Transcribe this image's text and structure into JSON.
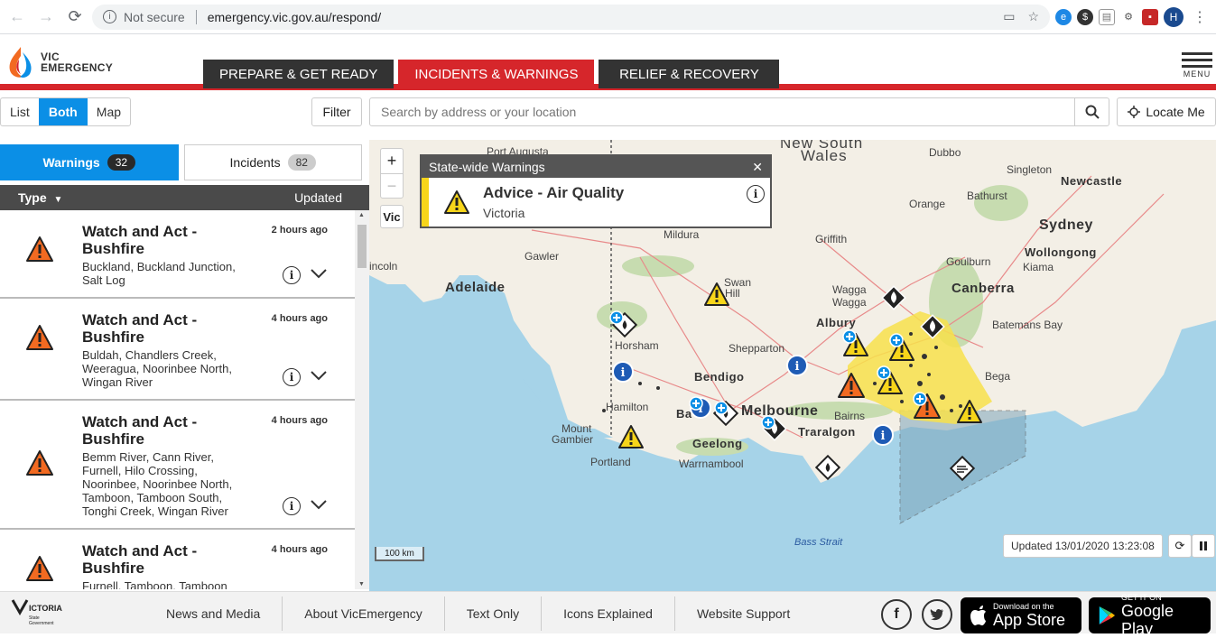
{
  "browser": {
    "security": "Not secure",
    "url": "emergency.vic.gov.au/respond/",
    "profile_initial": "H"
  },
  "site": {
    "logo_line1": "VIC",
    "logo_line2": "EMERGENCY",
    "nav": [
      {
        "label": "PREPARE & GET READY"
      },
      {
        "label": "INCIDENTS & WARNINGS",
        "active": true
      },
      {
        "label": "RELIEF & RECOVERY"
      }
    ],
    "menu_label": "MENU"
  },
  "toolbar": {
    "views": [
      "List",
      "Both",
      "Map"
    ],
    "active_view": "Both",
    "filter": "Filter",
    "search_placeholder": "Search by address or your location",
    "locate": "Locate Me"
  },
  "sidebar": {
    "tabs": [
      {
        "label": "Warnings",
        "count": "32",
        "active": true
      },
      {
        "label": "Incidents",
        "count": "82"
      }
    ],
    "columns": {
      "type": "Type",
      "updated": "Updated"
    },
    "items": [
      {
        "title": "Watch and Act - Bushfire",
        "time": "2 hours ago",
        "locations": "Buckland, Buckland Junction, Salt Log"
      },
      {
        "title": "Watch and Act - Bushfire",
        "time": "4 hours ago",
        "locations": "Buldah, Chandlers Creek, Weeragua, Noorinbee North, Wingan River"
      },
      {
        "title": "Watch and Act - Bushfire",
        "time": "4 hours ago",
        "locations": "Bemm River, Cann River, Furnell, Hilo Crossing, Noorinbee, Noorinbee North, Tamboon, Tamboon South, Tonghi Creek, Wingan River"
      },
      {
        "title": "Watch and Act - Bushfire",
        "time": "4 hours ago",
        "locations": "Furnell, Tamboon, Tamboon"
      }
    ]
  },
  "map": {
    "zoom_in": "+",
    "zoom_out": "−",
    "vic": "Vic",
    "popup": {
      "header": "State-wide Warnings",
      "title": "Advice - Air Quality",
      "subtitle": "Victoria"
    },
    "updated": "Updated 13/01/2020 13:23:08",
    "scale": "100 km",
    "labels": {
      "nsw1": "New South",
      "nsw2": "Wales",
      "dubbo": "Dubbo",
      "singleton": "Singleton",
      "newcastle": "Newcastle",
      "orange": "Orange",
      "bathurst": "Bathurst",
      "sydney": "Sydney",
      "wollongong": "Wollongong",
      "kiama": "Kiama",
      "griffith": "Griffith",
      "goulburn": "Goulburn",
      "canberra": "Canberra",
      "wagga1": "Wagga",
      "wagga2": "Wagga",
      "batemans": "Batemans Bay",
      "adelaide": "Adelaide",
      "portaugusta": "Port Augusta",
      "mildura": "Mildura",
      "gawler": "Gawler",
      "swanhill1": "Swan",
      "swanhill2": "Hill",
      "albury": "Albury",
      "shepparton": "Shepparton",
      "bendigo": "Bendigo",
      "horsham": "Horsham",
      "melbourne": "Melbourne",
      "bega": "Bega",
      "hamilton": "Hamilton",
      "ballarat": "Ba",
      "mountgambier1": "Mount",
      "mountgambier2": "Gambier",
      "geelong": "Geelong",
      "traralgon": "Traralgon",
      "bairnsdale": "Bairns",
      "portland": "Portland",
      "warrnambool": "Warrnambool",
      "bassstrait": "Bass Strait",
      "lincoln": "incoln"
    }
  },
  "footer": {
    "links": [
      "News and Media",
      "About VicEmergency",
      "Text Only",
      "Icons Explained",
      "Website Support"
    ],
    "appstore_small": "Download on the",
    "appstore_big": "App Store",
    "googleplay_small": "GET IT ON",
    "googleplay_big": "Google Play"
  },
  "colors": {
    "brand_red": "#d6262b",
    "accent_blue": "#0b8fe6",
    "watch_act": "#f26a21",
    "advice": "#f7d51a"
  }
}
